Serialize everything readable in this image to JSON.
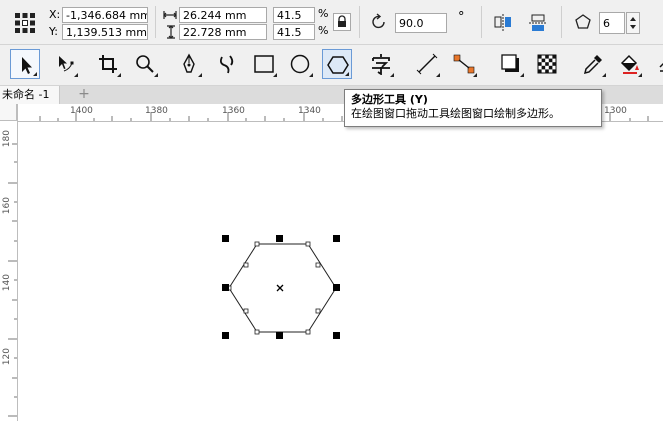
{
  "propbar": {
    "x_label": "X:",
    "x_value": "-1,346.684 mm",
    "y_label": "Y:",
    "y_value": "1,139.513 mm",
    "width_value": "26.244 mm",
    "height_value": "22.728 mm",
    "scale_x": "41.5",
    "scale_y": "41.5",
    "pct_x": "%",
    "pct_y": "%",
    "rotation": "90.0",
    "degree": "°",
    "sides": "6"
  },
  "tabs": [
    {
      "label": "未命名 -1"
    }
  ],
  "add_tab": "+",
  "ruler_h": [
    "1400",
    "1380",
    "1360",
    "1340",
    "1300"
  ],
  "ruler_v": [
    "180",
    "160",
    "140",
    "120"
  ],
  "tooltip": {
    "title": "多边形工具 (Y)",
    "description": "在绘图窗口拖动工具绘图窗口绘制多边形。"
  },
  "icons": {
    "polygon_tool": "hexagon-icon",
    "lock": "lock-icon"
  },
  "colors": {
    "accent": "#6a9ad6",
    "ribbon": "#f0f0f0"
  }
}
